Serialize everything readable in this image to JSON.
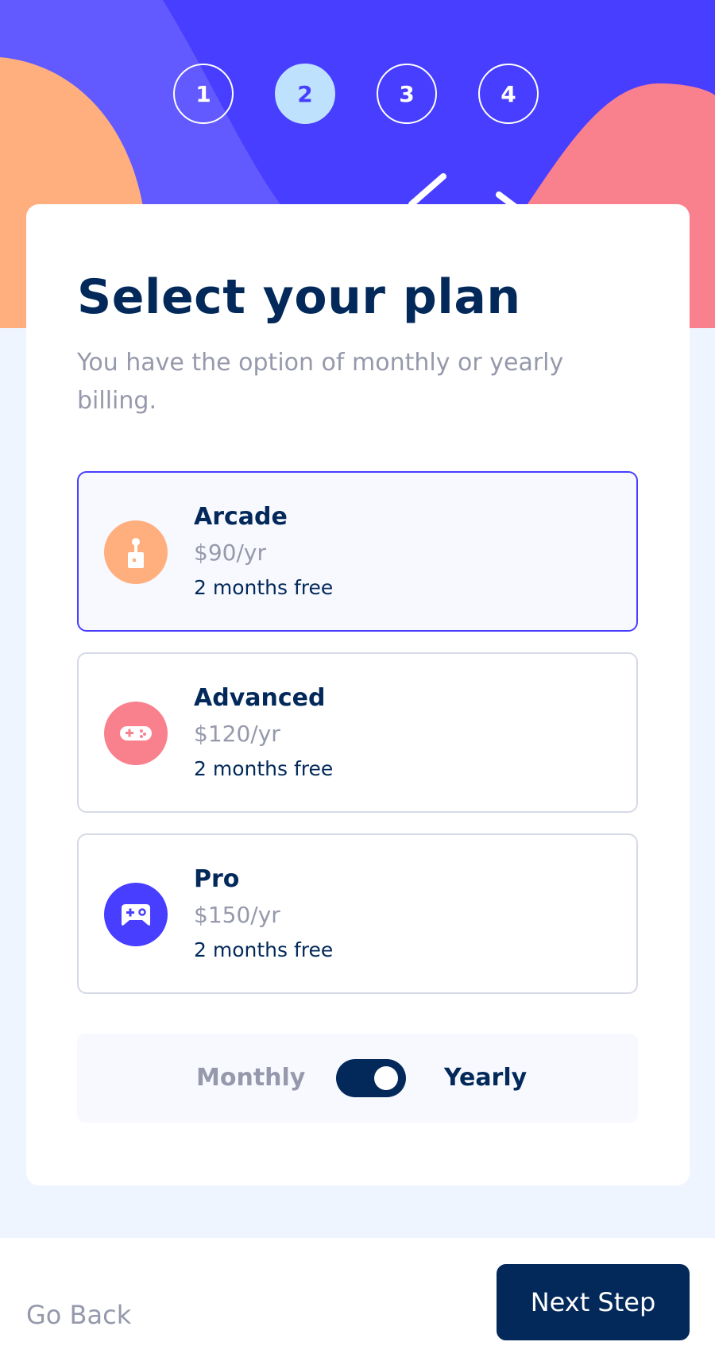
{
  "steps": [
    "1",
    "2",
    "3",
    "4"
  ],
  "active_step": "2",
  "header": {
    "title": "Select your plan",
    "subtitle": "You have the option of monthly or yearly billing."
  },
  "plans": [
    {
      "name": "Arcade",
      "price": "$90/yr",
      "promo": "2 months free",
      "icon": "arcade-joystick-icon",
      "color": "#ffaf7e",
      "selected": true
    },
    {
      "name": "Advanced",
      "price": "$120/yr",
      "promo": "2 months free",
      "icon": "gamepad-icon",
      "color": "#f9818e",
      "selected": false
    },
    {
      "name": "Pro",
      "price": "$150/yr",
      "promo": "2 months free",
      "icon": "controller-icon",
      "color": "#483eff",
      "selected": false
    }
  ],
  "billing": {
    "monthly_label": "Monthly",
    "yearly_label": "Yearly",
    "selected": "Yearly"
  },
  "footer": {
    "back_label": "Go Back",
    "next_label": "Next Step"
  },
  "colors": {
    "marine_blue": "#02295a",
    "purplish_blue": "#483eff",
    "light_blue": "#bee2fd",
    "cool_gray": "#9699ab",
    "light_gray": "#d6d9e6",
    "magnolia": "#f8f9fe",
    "alabaster": "#eff5ff",
    "orange": "#ffaf7e",
    "pink": "#f9818e"
  }
}
